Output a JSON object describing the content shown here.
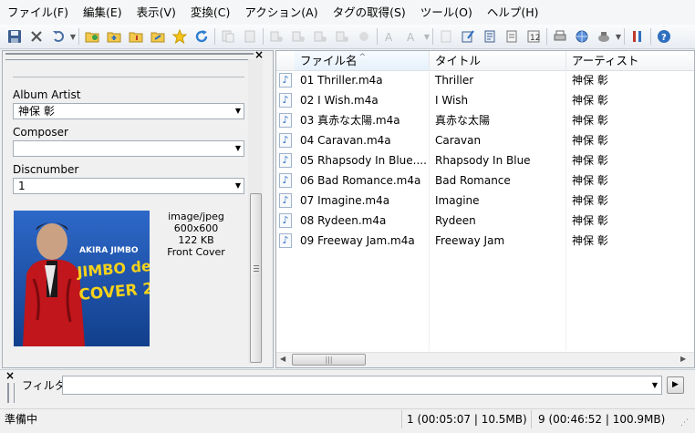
{
  "menu": [
    {
      "label": "ファイル(F)"
    },
    {
      "label": "編集(E)"
    },
    {
      "label": "表示(V)"
    },
    {
      "label": "変換(C)"
    },
    {
      "label": "アクション(A)"
    },
    {
      "label": "タグの取得(S)"
    },
    {
      "label": "ツール(O)"
    },
    {
      "label": "ヘルプ(H)"
    }
  ],
  "toolbar_icons": [
    "save-icon",
    "delete-icon",
    "undo-icon",
    "open-folder-icon",
    "add-folder-icon",
    "playlist-icon",
    "export-icon",
    "favorite-icon",
    "refresh-icon"
  ],
  "left_panel": {
    "close_glyph": "×",
    "fields": [
      {
        "label": "Album Artist",
        "value": "神保 彰"
      },
      {
        "label": "Composer",
        "value": ""
      },
      {
        "label": "Discnumber",
        "value": "1"
      }
    ],
    "cover": {
      "info_lines": [
        "image/jpeg",
        "600x600",
        "122 KB",
        "Front Cover"
      ],
      "artist_text": "AKIRA JIMBO",
      "title_line1": "JIMBO de",
      "title_line2": "COVER 2",
      "colors": {
        "background": "#1b4fa8",
        "jacket": "#c0161c",
        "title": "#f6d21a"
      }
    }
  },
  "list": {
    "columns": [
      "ファイル名",
      "タイトル",
      "アーティスト"
    ],
    "rows": [
      {
        "file": "01 Thriller.m4a",
        "title": "Thriller",
        "artist": "神保 彰"
      },
      {
        "file": "02 I Wish.m4a",
        "title": "I Wish",
        "artist": "神保 彰"
      },
      {
        "file": "03 真赤な太陽.m4a",
        "title": "真赤な太陽",
        "artist": "神保 彰"
      },
      {
        "file": "04 Caravan.m4a",
        "title": "Caravan",
        "artist": "神保 彰"
      },
      {
        "file": "05 Rhapsody In Blue....",
        "title": "Rhapsody In Blue",
        "artist": "神保 彰"
      },
      {
        "file": "06 Bad Romance.m4a",
        "title": "Bad Romance",
        "artist": "神保 彰"
      },
      {
        "file": "07 Imagine.m4a",
        "title": "Imagine",
        "artist": "神保 彰"
      },
      {
        "file": "08 Rydeen.m4a",
        "title": "Rydeen",
        "artist": "神保 彰"
      },
      {
        "file": "09 Freeway Jam.m4a",
        "title": "Freeway Jam",
        "artist": "神保 彰"
      }
    ]
  },
  "filter": {
    "close_glyph": "×",
    "label": "フィルタ:",
    "value": ""
  },
  "status": {
    "state": "準備中",
    "selection": "1 (00:05:07 | 10.5MB)",
    "total": "9 (00:46:52 | 100.9MB)"
  },
  "colors": {
    "accent": "#2f6fc0",
    "panel_border": "#a9b0ba"
  }
}
